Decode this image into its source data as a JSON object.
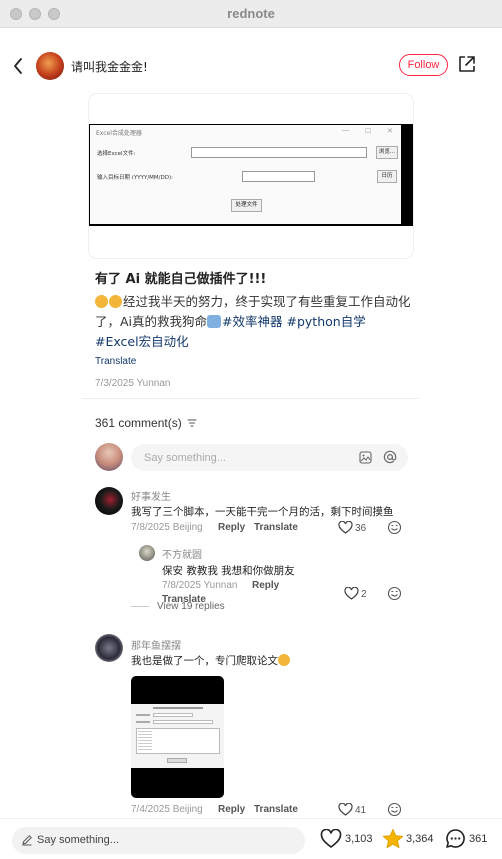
{
  "window": {
    "title": "rednote"
  },
  "header": {
    "author": "请叫我金金金!",
    "follow_label": "Follow"
  },
  "image_card": {
    "window_title": "Excel合成处理器",
    "file_label": "选择Excel文件:",
    "browse_label": "浏览...",
    "date_label": "输入目标日期 (YYYY/MM/DD):",
    "calendar_label": "日历",
    "process_label": "处理文件"
  },
  "post": {
    "title": "有了 Ai 就能自己做插件了!!!",
    "body_text": "经过我半天的努力，终于实现了有些重复工作自动化了，Ai真的救我狗命",
    "tag1": "#效率神器",
    "tag2": "#python自学",
    "tag3": "#Excel宏自动化",
    "translate": "Translate",
    "date": "7/3/2025 Yunnan"
  },
  "comments_header": {
    "count": "361 comment(s)"
  },
  "comment_input": {
    "placeholder": "Say something..."
  },
  "comments": [
    {
      "name": "好事发生",
      "text": "我写了三个脚本，一天能干完一个月的活，剩下时间摸鱼",
      "date": "7/8/2025 Beijing",
      "reply": "Reply",
      "translate": "Translate",
      "likes": "36",
      "replies": [
        {
          "name": "不方就圆",
          "text": "保安  教教我 我想和你做朋友",
          "date": "7/8/2025 Yunnan",
          "reply": "Reply",
          "translate": "Translate",
          "likes": "2"
        }
      ],
      "view_replies": "View 19 replies"
    },
    {
      "name": "那年鱼摆摆",
      "text": "我也是做了一个，专门爬取论文",
      "date": "7/4/2025 Beijing",
      "reply": "Reply",
      "translate": "Translate",
      "likes": "41"
    }
  ],
  "bottom_bar": {
    "placeholder": "Say something...",
    "likes": "3,103",
    "stars": "3,364",
    "comments": "361"
  },
  "colors": {
    "accent": "#ff2442",
    "link": "#13386c",
    "star": "#f5b400"
  }
}
